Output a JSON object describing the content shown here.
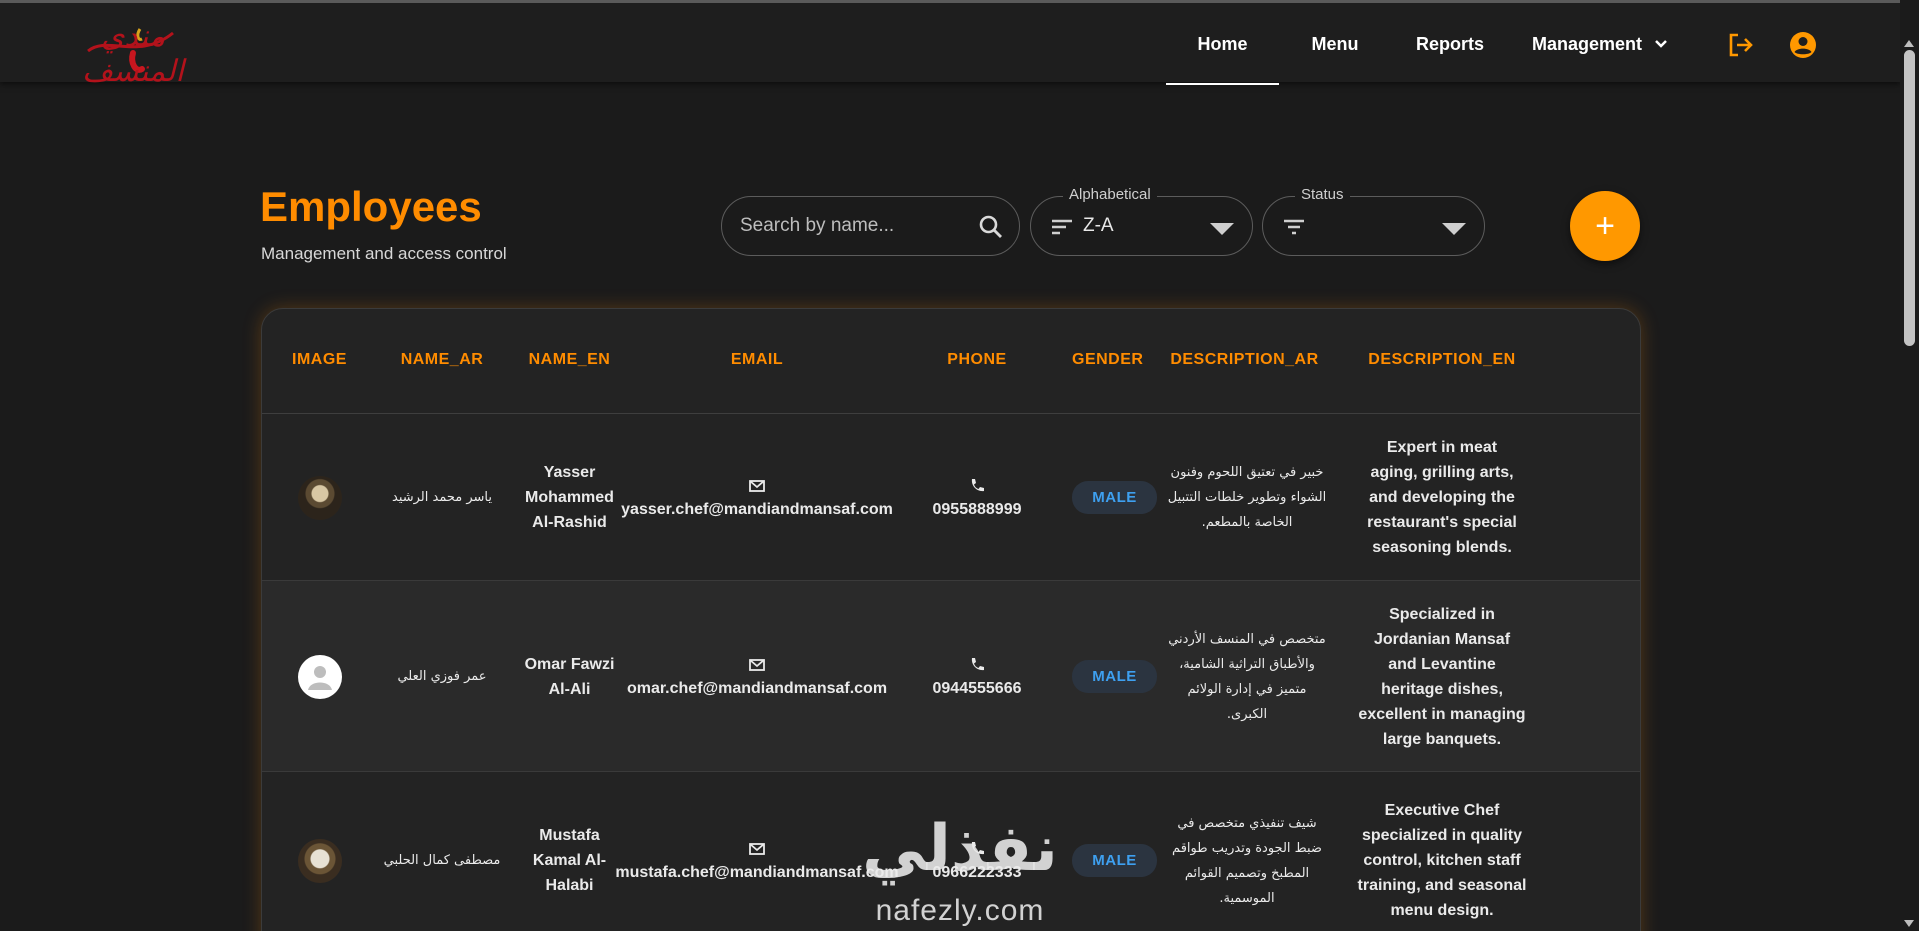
{
  "app": {
    "logo_text": "مندي المنسف"
  },
  "nav": {
    "items": [
      {
        "label": "Home",
        "active": true
      },
      {
        "label": "Menu"
      },
      {
        "label": "Reports"
      },
      {
        "label": "Management"
      }
    ],
    "icons": [
      "logout-icon",
      "account-circle-icon"
    ],
    "accent_color": "#ff9800"
  },
  "page": {
    "title": "Employees",
    "subtitle": "Management and access control"
  },
  "search": {
    "placeholder": "Search by name...",
    "value": ""
  },
  "filters": {
    "sort": {
      "legend": "Alphabetical",
      "value": "Z-A"
    },
    "status": {
      "legend": "Status",
      "value": ""
    }
  },
  "add_button": {
    "label": "+"
  },
  "table": {
    "columns": [
      "IMAGE",
      "NAME_AR",
      "NAME_EN",
      "EMAIL",
      "PHONE",
      "GENDER",
      "DESCRIPTION_AR",
      "DESCRIPTION_EN"
    ],
    "rows": [
      {
        "image": "photo",
        "name_ar": "ياسر محمد الرشيد",
        "name_en": "Yasser Mohammed Al-Rashid",
        "email": "yasser.chef@mandiandmansaf.com",
        "phone": "0955888999",
        "gender": "MALE",
        "description_ar": "خبير في تعتيق اللحوم وفنون الشواء وتطوير خلطات التتبيل الخاصة بالمطعم.",
        "description_en": "Expert in meat aging, grilling arts, and developing the restaurant's special seasoning blends."
      },
      {
        "image": "placeholder",
        "name_ar": "عمر فوزي العلي",
        "name_en": "Omar Fawzi Al-Ali",
        "email": "omar.chef@mandiandmansaf.com",
        "phone": "0944555666",
        "gender": "MALE",
        "description_ar": "متخصص في المنسف الأردني والأطباق التراثية الشامية، متميز في إدارة الولائم الكبرى.",
        "description_en": "Specialized in Jordanian Mansaf and Levantine heritage dishes, excellent in managing large banquets."
      },
      {
        "image": "photo",
        "name_ar": "مصطفى كمال الحلبي",
        "name_en": "Mustafa Kamal Al-Halabi",
        "email": "mustafa.chef@mandiandmansaf.com",
        "phone": "0966222333",
        "gender": "MALE",
        "description_ar": "شيف تنفيذي متخصص في ضبط الجودة وتدريب طواقم المطبخ وتصميم القوائم الموسمية.",
        "description_en": "Executive Chef specialized in quality control, kitchen staff training, and seasonal menu design."
      }
    ]
  },
  "watermark": {
    "text_ar": "نفذلي",
    "text_en": "nafezly.com"
  }
}
